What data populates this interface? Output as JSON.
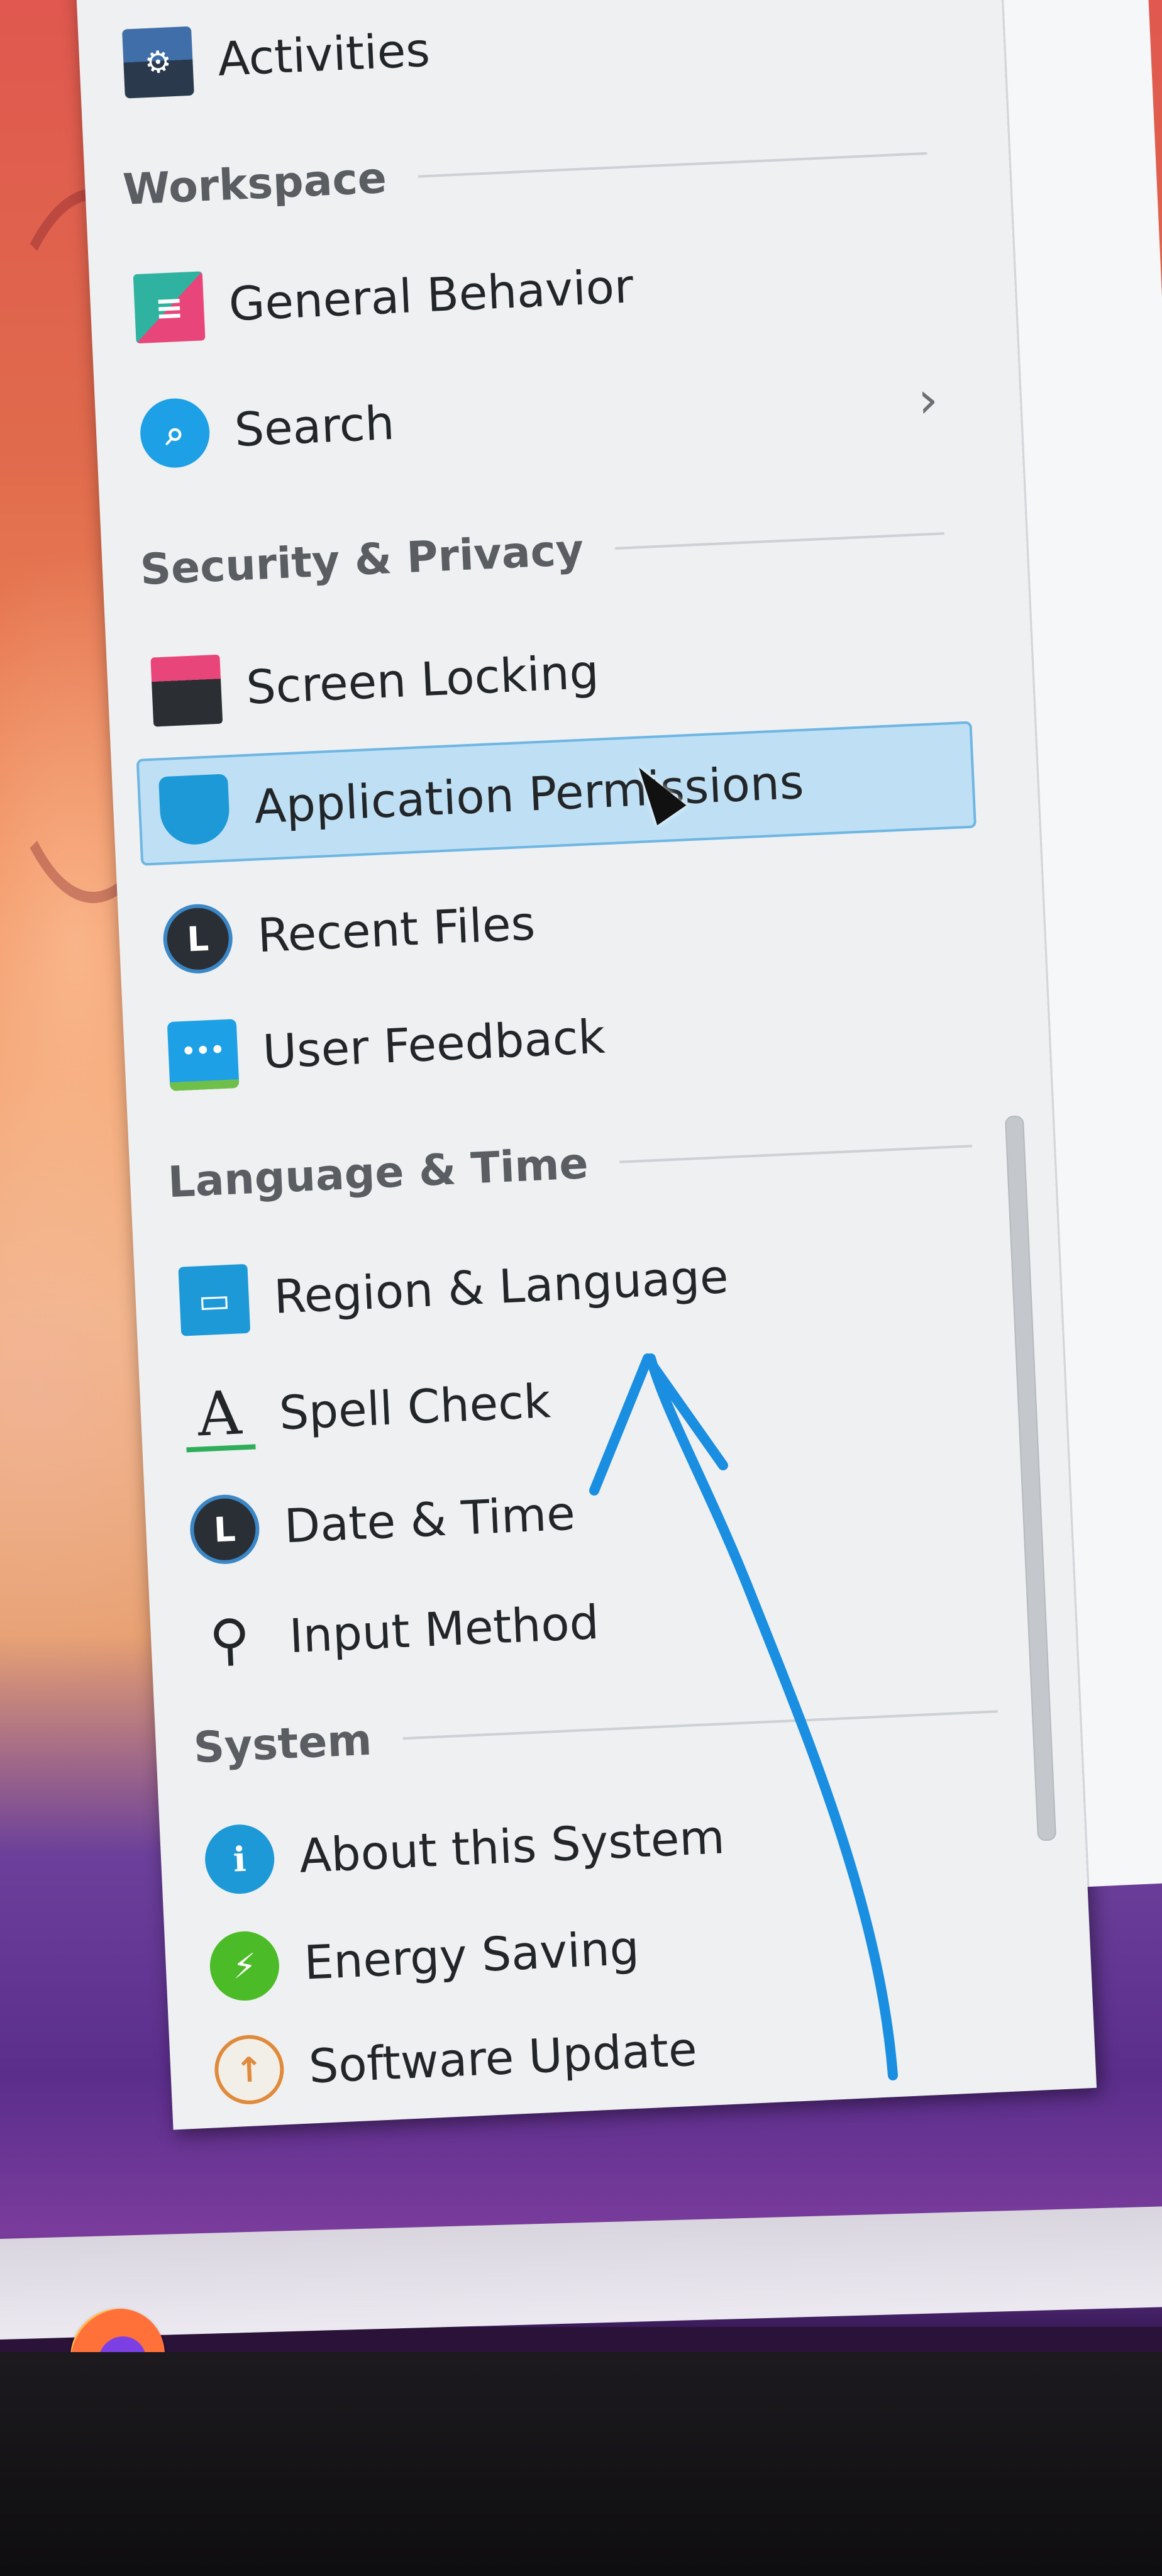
{
  "panel": {
    "top_item": {
      "label": "Activities",
      "icon": "activities-icon"
    },
    "sections": [
      {
        "title": "Workspace",
        "items": [
          {
            "label": "General Behavior",
            "icon": "general-behavior-icon"
          },
          {
            "label": "Search",
            "icon": "search-icon",
            "has_chevron": true
          }
        ]
      },
      {
        "title": "Security & Privacy",
        "items": [
          {
            "label": "Screen Locking",
            "icon": "screen-lock-icon"
          },
          {
            "label": "Application Permissions",
            "icon": "shield-icon",
            "selected": true
          },
          {
            "label": "Recent Files",
            "icon": "clock-icon"
          },
          {
            "label": "User Feedback",
            "icon": "feedback-icon"
          }
        ]
      },
      {
        "title": "Language & Time",
        "items": [
          {
            "label": "Region & Language",
            "icon": "region-language-icon"
          },
          {
            "label": "Spell Check",
            "icon": "spell-check-icon"
          },
          {
            "label": "Date & Time",
            "icon": "clock-icon"
          },
          {
            "label": "Input Method",
            "icon": "input-method-icon"
          }
        ]
      },
      {
        "title": "System",
        "items": [
          {
            "label": "About this System",
            "icon": "info-icon"
          },
          {
            "label": "Energy Saving",
            "icon": "energy-icon"
          },
          {
            "label": "Software Update",
            "icon": "update-icon"
          }
        ]
      }
    ],
    "chevron_glyph": "›"
  },
  "icon_glyphs": {
    "activities": "⚙",
    "general": "≡",
    "search": "⌕",
    "screenlock": "🔒",
    "shield": "🔒",
    "clock": "L",
    "feedback": "•••",
    "region": "▭",
    "spell": "A",
    "input": "⚲",
    "info": "i",
    "energy": "⚡",
    "update": "↑"
  },
  "taskbar": {
    "apps": [
      {
        "name": "firefox",
        "icon": "firefox-icon"
      }
    ]
  },
  "colors": {
    "selection_bg": "#bfe0f4",
    "selection_border": "#6fb6e3",
    "annotation_arrow": "#1a8ee0"
  }
}
